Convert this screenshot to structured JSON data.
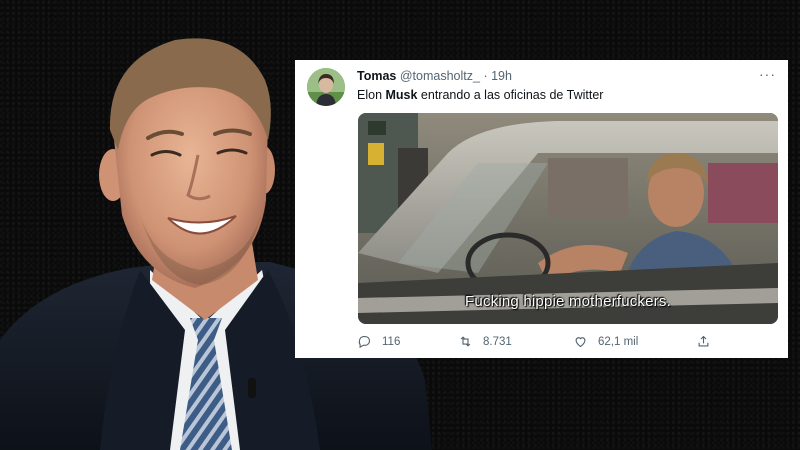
{
  "tweet": {
    "display_name": "Tomas",
    "handle": "@tomasholtz_",
    "separator": "·",
    "time": "19h",
    "more": "···",
    "text_before": "Elon ",
    "text_bold": "Musk",
    "text_after": " entrando a las oficinas de Twitter",
    "media": {
      "subtitle": "Fucking hippie motherfuckers."
    },
    "actions": {
      "replies": "116",
      "retweets": "8.731",
      "likes": "62,1 mil"
    }
  },
  "colors": {
    "background": "#0b0b0b",
    "card": "#ffffff",
    "text_primary": "#0f1419",
    "text_secondary": "#536471"
  }
}
